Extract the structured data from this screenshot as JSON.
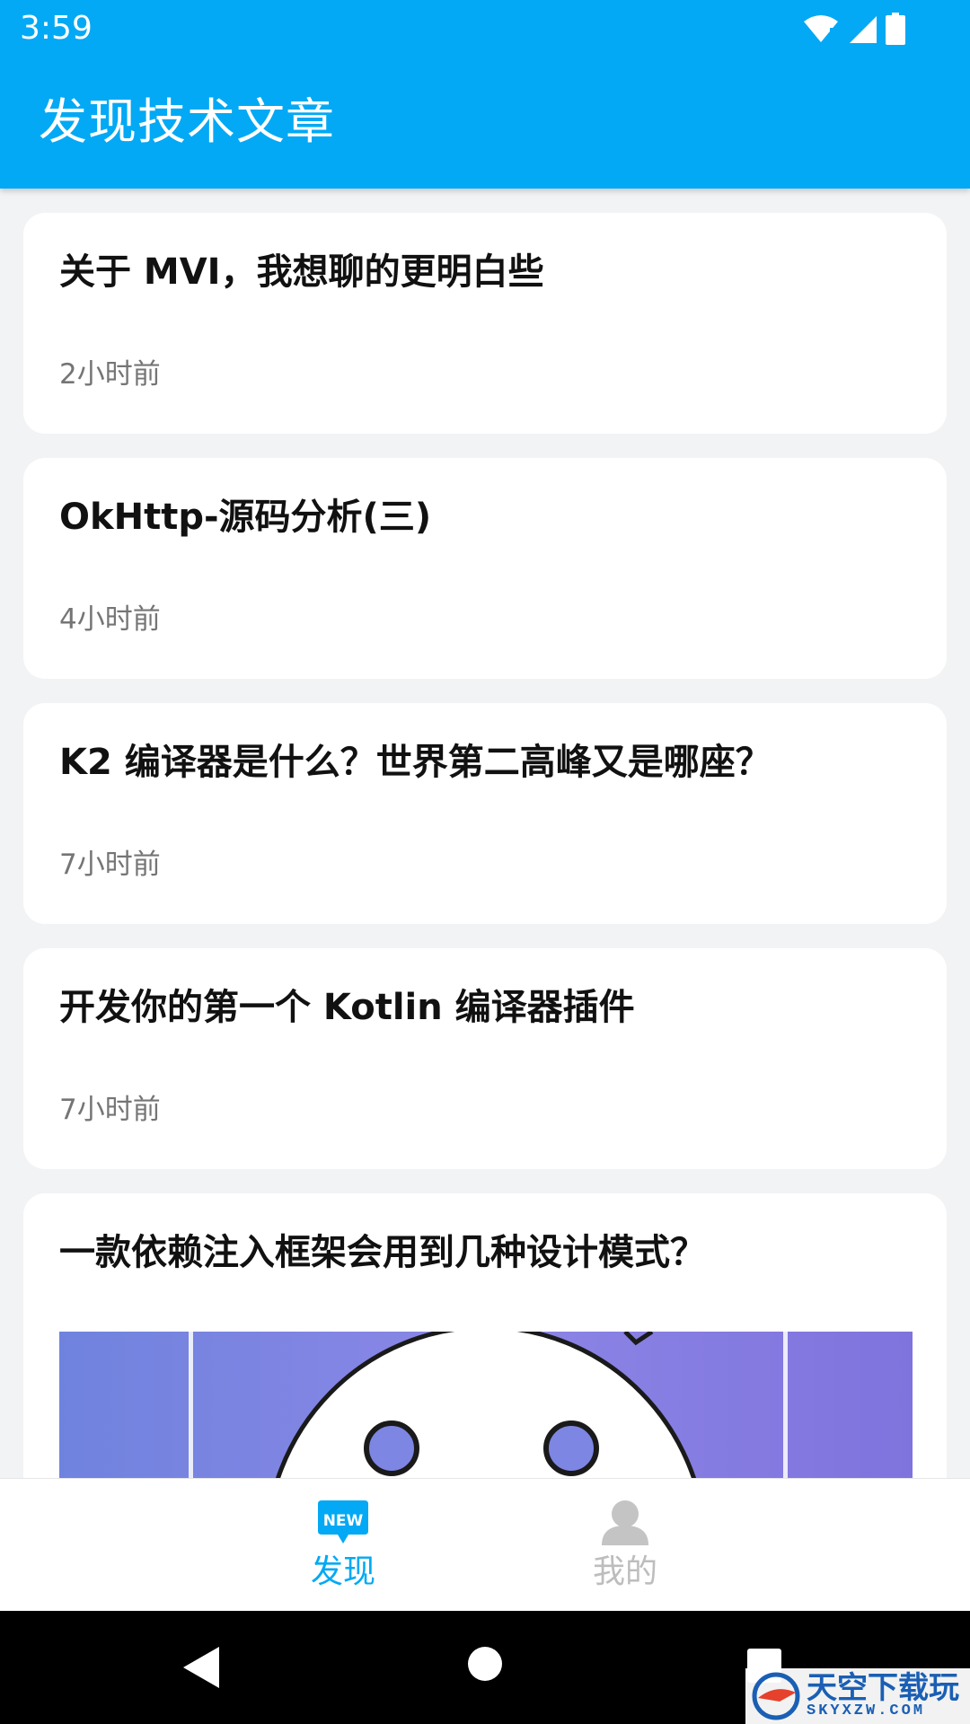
{
  "status_bar": {
    "time": "3:59"
  },
  "app_bar": {
    "title": "发现技术文章"
  },
  "articles": [
    {
      "title": "关于 MVI，我想聊的更明白些",
      "time": "2小时前"
    },
    {
      "title": "OkHttp-源码分析(三)",
      "time": "4小时前"
    },
    {
      "title": "K2 编译器是什么？世界第二高峰又是哪座？",
      "time": "7小时前"
    },
    {
      "title": "开发你的第一个 Kotlin 编译器插件",
      "time": "7小时前"
    },
    {
      "title": "一款依赖注入框架会用到几种设计模式？",
      "has_image": true
    }
  ],
  "bottom_nav": {
    "items": [
      {
        "label": "发现",
        "badge": "NEW",
        "active": true,
        "icon": "new-badge-icon"
      },
      {
        "label": "我的",
        "active": false,
        "icon": "person-icon"
      }
    ],
    "active_color": "#03a9f4",
    "inactive_color": "#bdbdbd"
  },
  "watermark": {
    "name": "天空下载玩",
    "url": "SKYXZW.COM"
  },
  "colors": {
    "primary": "#03a9f4",
    "background": "#f2f3f5"
  }
}
